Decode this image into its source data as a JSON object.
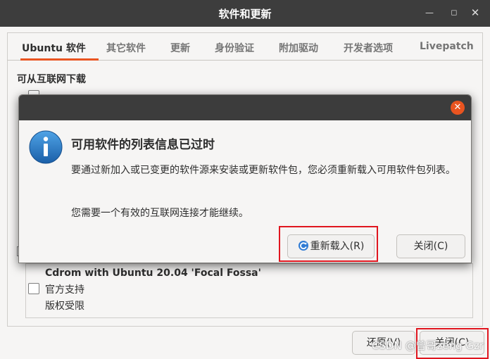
{
  "window": {
    "title": "软件和更新"
  },
  "tabs": [
    {
      "label": "Ubuntu 软件",
      "active": true
    },
    {
      "label": "其它软件"
    },
    {
      "label": "更新"
    },
    {
      "label": "身份验证"
    },
    {
      "label": "附加驱动"
    },
    {
      "label": "开发者选项"
    },
    {
      "label": "Livepatch"
    }
  ],
  "main": {
    "download_section_title": "可从互联网下载",
    "cdrom": {
      "title": "Cdrom with Ubuntu 20.04 'Focal Fossa'",
      "line1": "官方支持",
      "line2": "版权受限"
    },
    "revert_button": "还原(V)",
    "close_button": "关闭(C)"
  },
  "dialog": {
    "title": "可用软件的列表信息已过时",
    "body1": "要通过新加入或已变更的软件源来安装或更新软件包，您必须重新载入可用软件包列表。",
    "body2": "您需要一个有效的互联网连接才能继续。",
    "reload_button": "重新载入(R)",
    "close_button": "关闭(C)"
  },
  "watermark": "CSDN @曾哥zeng Gzr",
  "colors": {
    "accent": "#e95420",
    "titlebar": "#3d3d3d",
    "highlight_box": "#e0161f",
    "info_icon": "#1f77c4"
  }
}
